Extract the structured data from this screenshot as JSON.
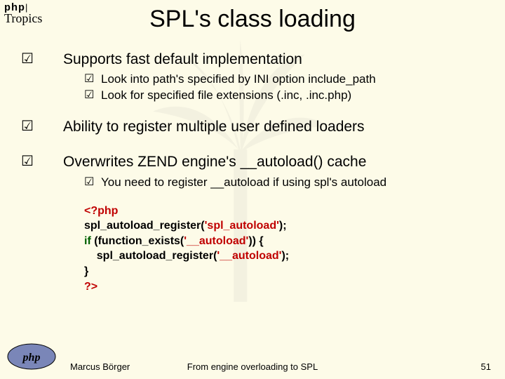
{
  "header": {
    "brand_top": "php",
    "brand_sub": "Tropics",
    "title": "SPL's class loading"
  },
  "bullets": [
    {
      "text": "Supports fast default implementation",
      "subs": [
        "Look into path's specified by INI option include_path",
        "Look for specified file extensions (.inc, .inc.php)"
      ]
    },
    {
      "text": "Ability to register multiple user defined loaders",
      "subs": []
    },
    {
      "text": "Overwrites ZEND engine's __autoload() cache",
      "subs": [
        "You need to register __autoload if using spl's autoload"
      ]
    }
  ],
  "code": {
    "open": "<?php",
    "l1a": "spl_autoload_register",
    "l1b": "'spl_autoload'",
    "l2a": "if",
    "l2b": "function_exists",
    "l2c": "'__autoload'",
    "l3a": "spl_autoload_register",
    "l3b": "'__autoload'",
    "close": "?>"
  },
  "footer": {
    "author": "Marcus Börger",
    "talk": "From engine overloading to SPL",
    "page": "51"
  },
  "glyphs": {
    "check": "☑"
  }
}
